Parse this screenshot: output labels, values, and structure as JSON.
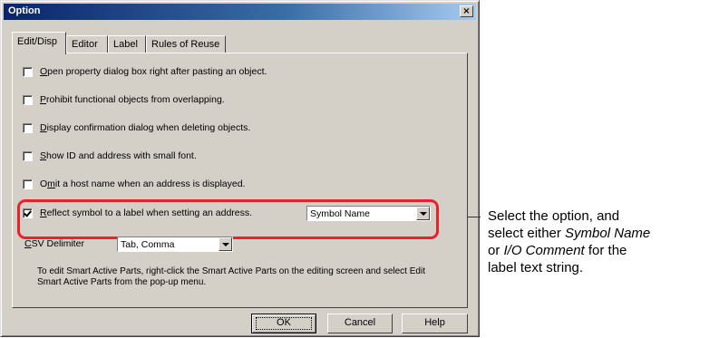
{
  "window": {
    "title": "Option",
    "close_glyph": "×"
  },
  "tabs": [
    {
      "label": "Edit/Disp",
      "active": true
    },
    {
      "label": "Editor",
      "active": false
    },
    {
      "label": "Label",
      "active": false
    },
    {
      "label": "Rules of Reuse",
      "active": false
    }
  ],
  "options": [
    {
      "mnemonic": "O",
      "rest": "pen property dialog box right after pasting an object.",
      "checked": false
    },
    {
      "mnemonic": "P",
      "rest": "rohibit functional objects from overlapping.",
      "checked": false
    },
    {
      "mnemonic": "D",
      "rest": "isplay confirmation dialog when deleting objects.",
      "checked": false
    },
    {
      "mnemonic": "S",
      "rest": "how ID and address with small font.",
      "checked": false
    },
    {
      "prefix": "O",
      "mnemonic": "m",
      "rest": "it a host name when an address is displayed.",
      "checked": false
    },
    {
      "mnemonic": "R",
      "rest": "eflect symbol to a label when setting an address.",
      "checked": true
    }
  ],
  "label_type_dropdown": {
    "value": "Symbol Name"
  },
  "csv": {
    "mnemonic": "C",
    "rest": "SV Delimiter",
    "value": "Tab, Comma"
  },
  "info": "To edit Smart Active Parts, right-click the Smart Active Parts on the editing screen and select Edit Smart Active Parts from the pop-up menu.",
  "buttons": {
    "ok": "OK",
    "cancel": "Cancel",
    "help": "Help"
  },
  "callout": {
    "line1": "Select the option, and",
    "line2_a": "select either ",
    "line2_b": "Symbol Name",
    "line3_a": "or ",
    "line3_b": "I/O Comment",
    "line3_c": " for the",
    "line4": "label text string."
  },
  "colors": {
    "highlight": "#e8222a",
    "title_bar": "#0a246a",
    "dialog_face": "#d4d0c8"
  }
}
